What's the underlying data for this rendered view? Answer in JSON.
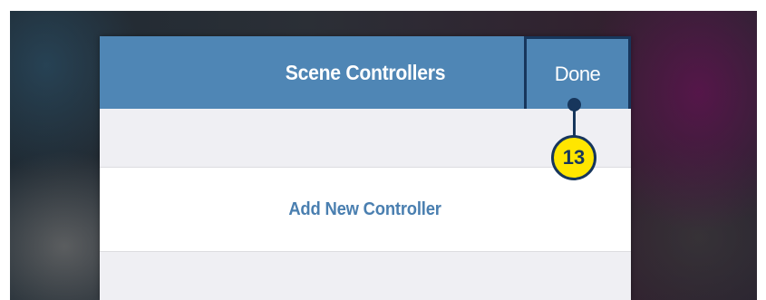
{
  "nav_bar": {
    "title": "Scene Controllers",
    "done_label": "Done"
  },
  "list": {
    "add_label": "Add New Controller"
  },
  "callout": {
    "number": "13"
  },
  "colors": {
    "nav_bar": "#4f86b5",
    "highlight_border": "#17365c",
    "callout_fill": "#ffe600",
    "link_text": "#4a7fb0",
    "list_background": "#efeff3"
  }
}
